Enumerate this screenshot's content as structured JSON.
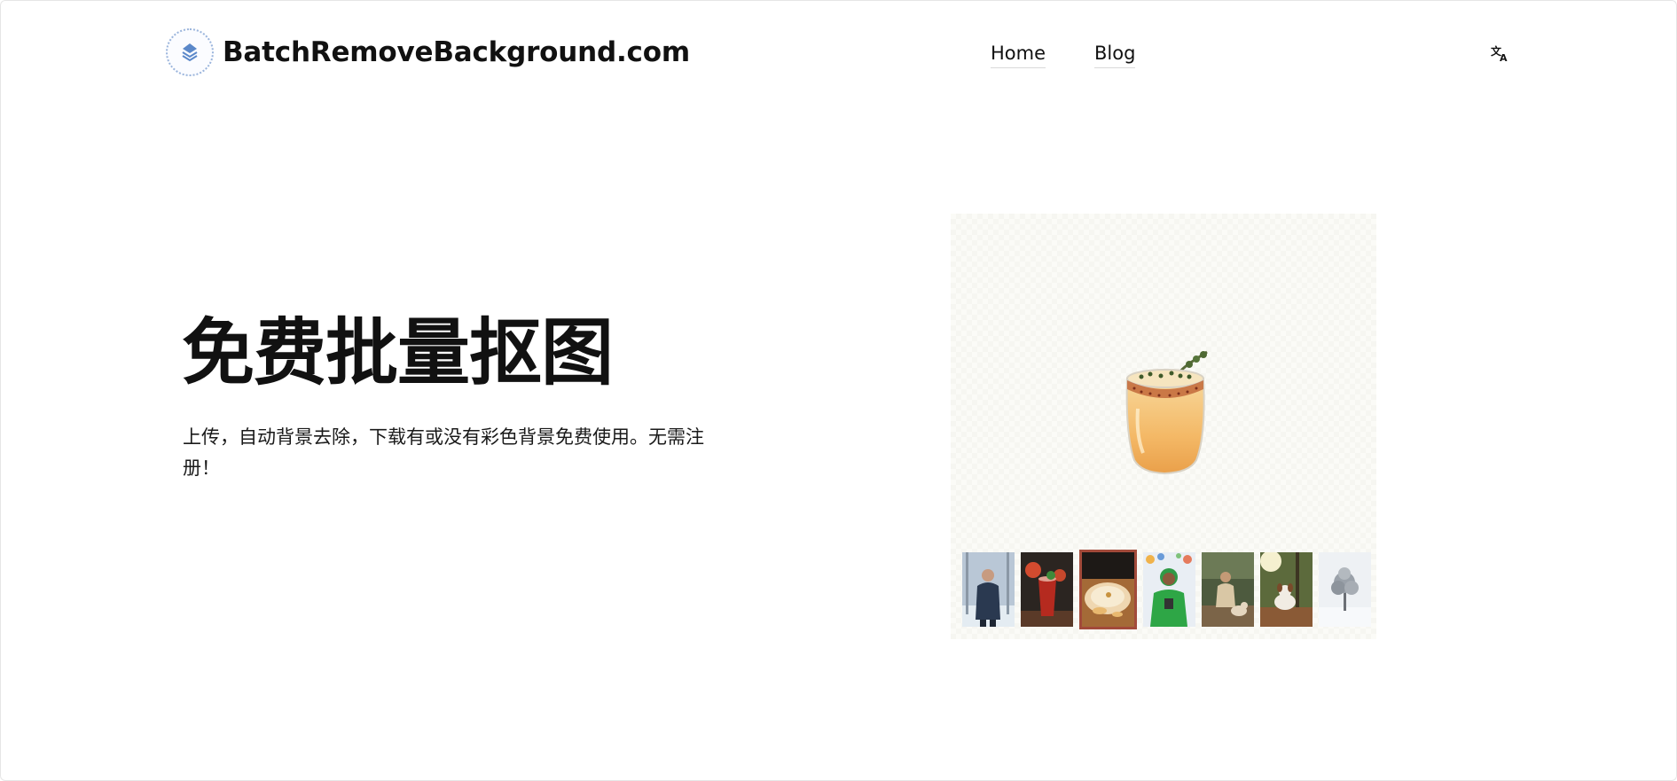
{
  "header": {
    "brand_name": "BatchRemoveBackground.com",
    "logo_icon": "layers-logo-icon",
    "nav": {
      "home": "Home",
      "blog": "Blog"
    },
    "language_icon": "translate-icon"
  },
  "hero": {
    "title": "免费批量抠图",
    "subtitle": "上传，自动背景去除，下载有或没有彩色背景免费使用。无需注册！"
  },
  "preview": {
    "main_image": "cocktail-glass-cutout",
    "selected_index": 2,
    "thumbnails": [
      "man-in-snow",
      "red-drink",
      "dessert-plate",
      "person-in-green-jacket",
      "woman-with-dog-outdoors",
      "dog-in-forest",
      "snowy-tree"
    ]
  },
  "colors": {
    "logo_accent": "#5b88c9",
    "selected_border": "#a24a3a",
    "preview_bg": "#fbfbf7"
  }
}
